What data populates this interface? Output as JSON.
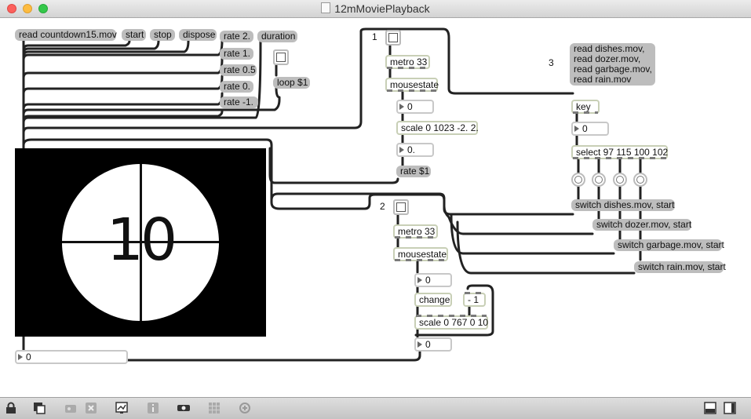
{
  "window": {
    "title": "12mMoviePlayback"
  },
  "patch": {
    "messages": {
      "read_countdown": "read countdown15.mov",
      "start": "start",
      "stop": "stop",
      "dispose": "dispose",
      "rate_2": "rate 2.",
      "rate_1": "rate 1.",
      "rate_05": "rate 0.5",
      "rate_0": "rate 0.",
      "rate_neg1": "rate -1.",
      "duration": "duration",
      "loop": "loop $1",
      "rate_var": "rate $1",
      "read_files": "read dishes.mov,\nread dozer.mov,\nread garbage.mov,\nread rain.mov",
      "switch_dishes": "switch dishes.mov, start",
      "switch_dozer": "switch dozer.mov, start",
      "switch_garbage": "switch garbage.mov, start",
      "switch_rain": "switch rain.mov, start"
    },
    "objects": {
      "metro1": "metro 33",
      "mousestate1": "mousestate",
      "scale1": "scale 0 1023 -2. 2.",
      "metro2": "metro 33",
      "mousestate2": "mousestate",
      "change": "change",
      "minus": "- 1",
      "scale2": "scale 0 767 0 10",
      "key": "key",
      "select": "select 97 115 100 102"
    },
    "numbers": {
      "num1": "0",
      "num2": "0.",
      "num3": "0",
      "num4": "0",
      "num_key": "0",
      "num_bottom": "0"
    },
    "comments": {
      "c1": "1",
      "c2": "2",
      "c3": "3"
    },
    "movie": {
      "frame_text": "10"
    }
  },
  "toolbar": {
    "icons": [
      "lock-icon",
      "presentation-icon",
      "grid-paint-icon",
      "delete-icon",
      "debug-icon",
      "inspector-icon",
      "object-icon",
      "grid-icon",
      "zoom-icon",
      "split-view-icon",
      "sidebar-icon"
    ]
  }
}
